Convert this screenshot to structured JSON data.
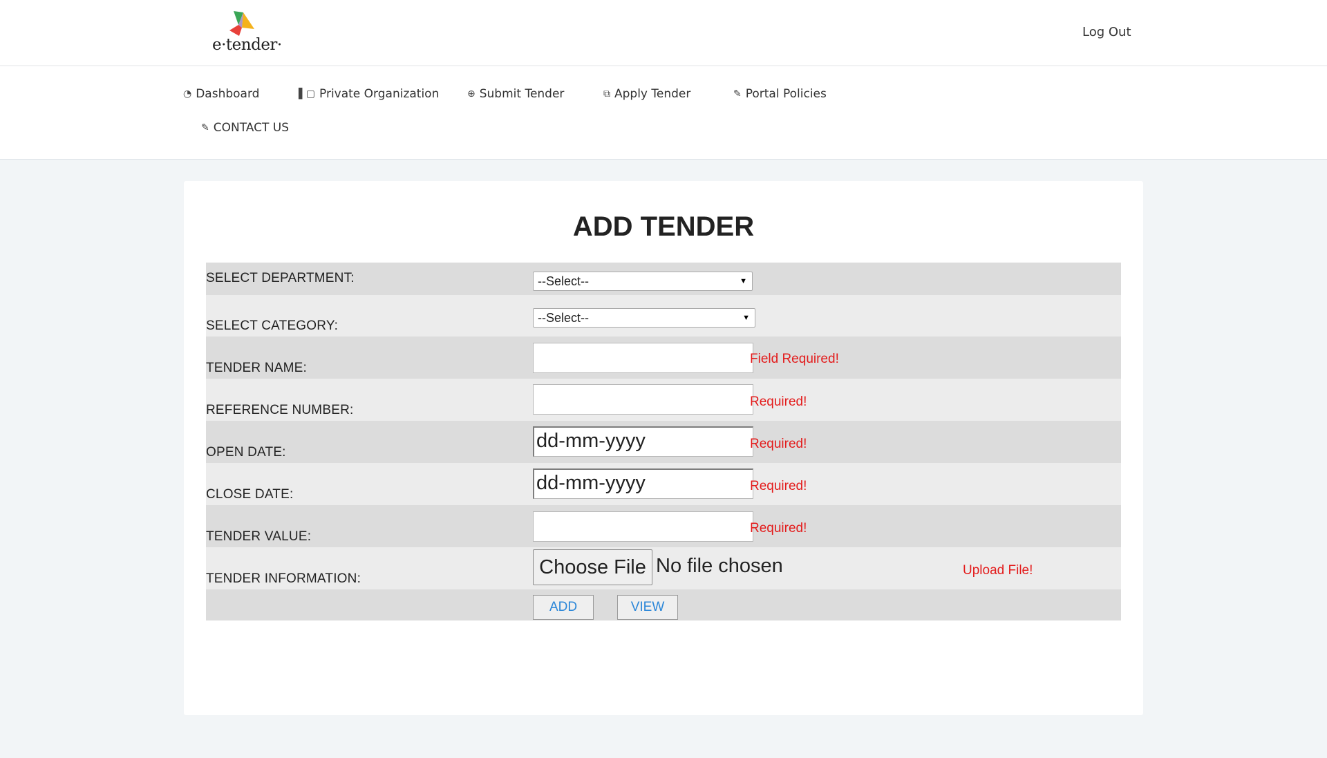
{
  "header": {
    "logo_text": "e·tender·",
    "logout_label": "Log Out"
  },
  "nav": {
    "items": [
      {
        "label": "Dashboard",
        "icon": "dashboard-icon"
      },
      {
        "label": "Private Organization",
        "icon": "book-icon"
      },
      {
        "label": "Submit Tender",
        "icon": "globe-icon"
      },
      {
        "label": "Apply Tender",
        "icon": "copy-icon"
      },
      {
        "label": "Portal Policies",
        "icon": "pencil-icon"
      },
      {
        "label": "CONTACT US",
        "icon": "pencil-icon"
      }
    ]
  },
  "form": {
    "title": "ADD TENDER",
    "department": {
      "label": "SELECT DEPARTMENT:",
      "value": "--Select--"
    },
    "category": {
      "label": "SELECT CATEGORY:",
      "value": "--Select--"
    },
    "tender_name": {
      "label": "TENDER NAME:",
      "value": "",
      "error": "Field Required!"
    },
    "reference_number": {
      "label": "REFERENCE NUMBER:",
      "value": "",
      "error": "Required!"
    },
    "open_date": {
      "label": "OPEN DATE:",
      "placeholder": "dd-mm-yyyy",
      "error": "Required!"
    },
    "close_date": {
      "label": "CLOSE DATE:",
      "placeholder": "dd-mm-yyyy",
      "error": "Required!"
    },
    "tender_value": {
      "label": "TENDER VALUE:",
      "value": "",
      "error": "Required!"
    },
    "tender_information": {
      "label": "TENDER INFORMATION:",
      "button": "Choose File",
      "status": "No file chosen",
      "error": "Upload File!"
    },
    "actions": {
      "add": "ADD",
      "view": "VIEW"
    }
  },
  "colors": {
    "page_bg": "#f2f5f7",
    "row_dark": "#dcdcdc",
    "row_light": "#ececec",
    "error": "#e31b1b",
    "button_text": "#2a86d8"
  }
}
